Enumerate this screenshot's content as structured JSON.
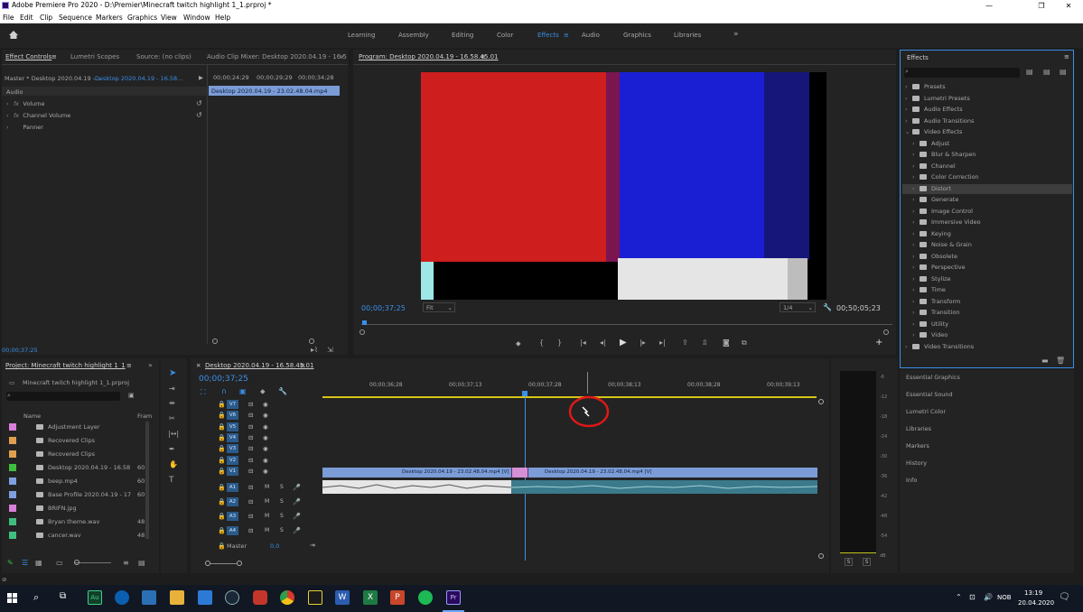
{
  "window": {
    "title": "Adobe Premiere Pro 2020 - D:\\Premier\\Minecraft twitch highlight 1_1.prproj *"
  },
  "menu": [
    "File",
    "Edit",
    "Clip",
    "Sequence",
    "Markers",
    "Graphics",
    "View",
    "Window",
    "Help"
  ],
  "workspaces": [
    "Learning",
    "Assembly",
    "Editing",
    "Color",
    "Effects",
    "Audio",
    "Graphics",
    "Libraries"
  ],
  "active_workspace": "Effects",
  "source_panel": {
    "tabs": [
      "Effect Controls",
      "Lumetri Scopes",
      "Source: (no clips)",
      "Audio Clip Mixer: Desktop 2020.04.19 - 16.5"
    ],
    "master": "Master * Desktop 2020.04.19 -...",
    "clip": "Desktop 2020.04.19 - 16.58...",
    "times": [
      "00;00;24;29",
      "00;00;29;29",
      "00;00;34;28"
    ],
    "clip_bar": "Desktop 2020.04.19 - 23.02.48.04.mp4",
    "section": "Audio",
    "rows": [
      "Volume",
      "Channel Volume",
      "Panner"
    ],
    "timecode": "00;00;37;25"
  },
  "program": {
    "title": "Program: Desktop 2020.04.19 - 16.58.45.01",
    "timecode": "00;00;37;25",
    "fit": "Fit",
    "resolution": "1/4",
    "duration": "00;50;05;23"
  },
  "effects": {
    "title": "Effects",
    "items": [
      {
        "label": "Presets",
        "indent": 0,
        "open": false
      },
      {
        "label": "Lumetri Presets",
        "indent": 0,
        "open": false
      },
      {
        "label": "Audio Effects",
        "indent": 0,
        "open": false
      },
      {
        "label": "Audio Transitions",
        "indent": 0,
        "open": false
      },
      {
        "label": "Video Effects",
        "indent": 0,
        "open": true
      },
      {
        "label": "Adjust",
        "indent": 1,
        "open": false
      },
      {
        "label": "Blur & Sharpen",
        "indent": 1,
        "open": false
      },
      {
        "label": "Channel",
        "indent": 1,
        "open": false
      },
      {
        "label": "Color Correction",
        "indent": 1,
        "open": false
      },
      {
        "label": "Distort",
        "indent": 1,
        "open": false,
        "selected": true
      },
      {
        "label": "Generate",
        "indent": 1,
        "open": false
      },
      {
        "label": "Image Control",
        "indent": 1,
        "open": false
      },
      {
        "label": "Immersive Video",
        "indent": 1,
        "open": false
      },
      {
        "label": "Keying",
        "indent": 1,
        "open": false
      },
      {
        "label": "Noise & Grain",
        "indent": 1,
        "open": false
      },
      {
        "label": "Obsolete",
        "indent": 1,
        "open": false
      },
      {
        "label": "Perspective",
        "indent": 1,
        "open": false
      },
      {
        "label": "Stylize",
        "indent": 1,
        "open": false
      },
      {
        "label": "Time",
        "indent": 1,
        "open": false
      },
      {
        "label": "Transform",
        "indent": 1,
        "open": false
      },
      {
        "label": "Transition",
        "indent": 1,
        "open": false
      },
      {
        "label": "Utility",
        "indent": 1,
        "open": false
      },
      {
        "label": "Video",
        "indent": 1,
        "open": false
      },
      {
        "label": "Video Transitions",
        "indent": 0,
        "open": false
      }
    ],
    "stacked": [
      "Essential Graphics",
      "Essential Sound",
      "Lumetri Color",
      "Libraries",
      "Markers",
      "History",
      "Info"
    ]
  },
  "project": {
    "title": "Project: Minecraft twitch highlight 1_1",
    "file": "Minecraft twitch highlight 1_1.prproj",
    "col_name": "Name",
    "col_fr": "Fram",
    "items": [
      {
        "name": "Adjustment Layer",
        "color": "#d97fd9",
        "fr": ""
      },
      {
        "name": "Recovered Clips",
        "color": "#e0a050",
        "fr": ""
      },
      {
        "name": "Recovered Clips",
        "color": "#e0a050",
        "fr": ""
      },
      {
        "name": "Desktop 2020.04.19 - 16.58",
        "color": "#3fbf3f",
        "fr": "60"
      },
      {
        "name": "beep.mp4",
        "color": "#7f9fdf",
        "fr": "60"
      },
      {
        "name": "Base Profile 2020.04.19 - 17",
        "color": "#7f9fdf",
        "fr": "60"
      },
      {
        "name": "BRIFN.jpg",
        "color": "#d97fd9",
        "fr": ""
      },
      {
        "name": "Bryan theme.wav",
        "color": "#3fbf7f",
        "fr": "48"
      },
      {
        "name": "cancer.wav",
        "color": "#3fbf7f",
        "fr": "48"
      }
    ]
  },
  "timeline": {
    "title": "Desktop 2020.04.19 - 16.58.45.01",
    "timecode": "00;00;37;25",
    "ruler": [
      "00;00;36;28",
      "00;00;37;13",
      "00;00;37;28",
      "00;00;38;13",
      "00;00;38;28",
      "00;00;39;13"
    ],
    "video_tracks": [
      "V7",
      "V6",
      "V5",
      "V4",
      "V3",
      "V2",
      "V1"
    ],
    "audio_tracks": [
      "A1",
      "A2",
      "A3",
      "A4"
    ],
    "master": "Master",
    "master_val": "0,0",
    "clip1": "Desktop 2020.04.19 - 23.02.48.04.mp4 [V]",
    "clip2": "Desktop 2020.04.19 - 23.02.48.04.mp4 [V]",
    "mute": "M",
    "solo": "S"
  },
  "meters": {
    "labels": [
      "-6",
      "-12",
      "-18",
      "-24",
      "-30",
      "-36",
      "-42",
      "-48",
      "-54",
      "dB"
    ],
    "solo_buttons": [
      "S",
      "S"
    ]
  },
  "taskbar": {
    "time": "13:19",
    "date": "20.04.2020",
    "lang": "NOB"
  }
}
